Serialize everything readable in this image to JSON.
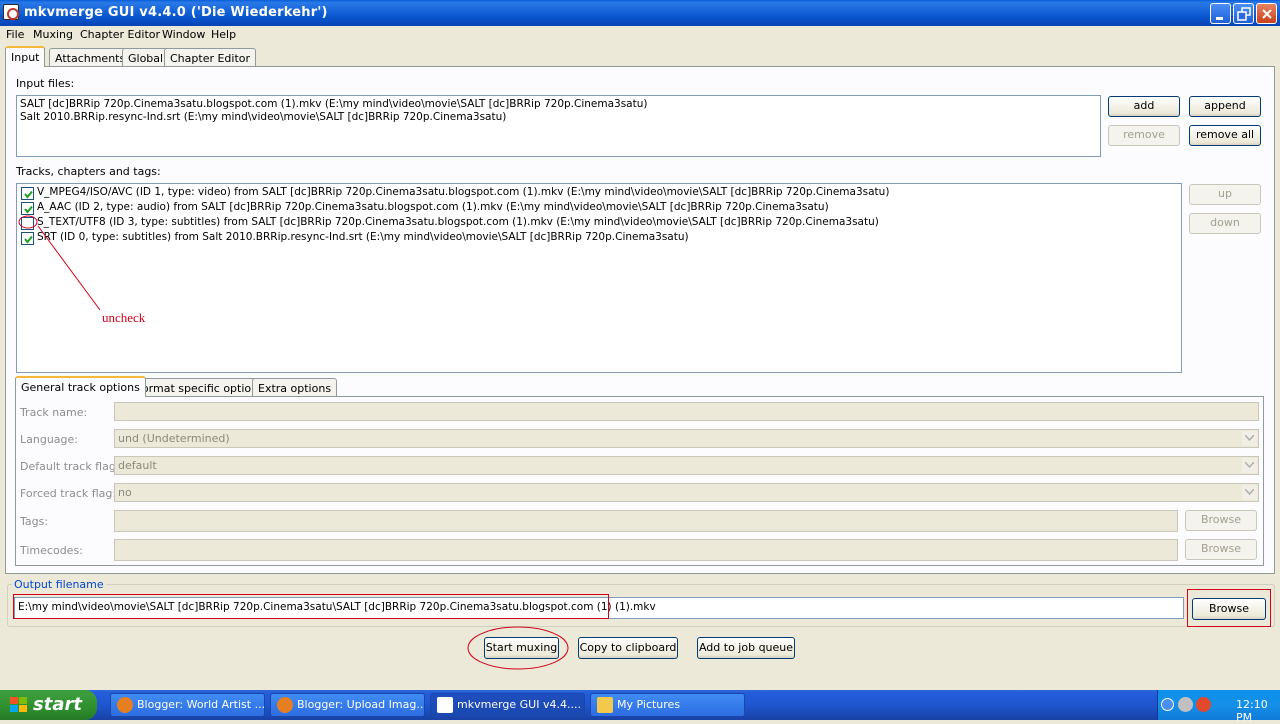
{
  "window": {
    "title": "mkvmerge GUI v4.4.0 ('Die Wiederkehr')"
  },
  "menu": [
    "File",
    "Muxing",
    "Chapter Editor",
    "Window",
    "Help"
  ],
  "tabs": [
    "Input",
    "Attachments",
    "Global",
    "Chapter Editor"
  ],
  "input_files": {
    "label": "Input files:",
    "files": [
      "SALT [dc]BRRip 720p.Cinema3satu.blogspot.com (1).mkv (E:\\my mind\\video\\movie\\SALT [dc]BRRip 720p.Cinema3satu)",
      "Salt 2010.BRRip.resync-Ind.srt (E:\\my mind\\video\\movie\\SALT [dc]BRRip 720p.Cinema3satu)"
    ],
    "buttons": {
      "add": "add",
      "append": "append",
      "remove": "remove",
      "remove_all": "remove all"
    }
  },
  "tracks": {
    "label": "Tracks, chapters and tags:",
    "items": [
      {
        "text": "V_MPEG4/ISO/AVC (ID 1, type: video) from SALT [dc]BRRip 720p.Cinema3satu.blogspot.com (1).mkv (E:\\my mind\\video\\movie\\SALT [dc]BRRip 720p.Cinema3satu)",
        "checked": true
      },
      {
        "text": "A_AAC (ID 2, type: audio) from SALT [dc]BRRip 720p.Cinema3satu.blogspot.com (1).mkv (E:\\my mind\\video\\movie\\SALT [dc]BRRip 720p.Cinema3satu)",
        "checked": true
      },
      {
        "text": "S_TEXT/UTF8 (ID 3, type: subtitles) from SALT [dc]BRRip 720p.Cinema3satu.blogspot.com (1).mkv (E:\\my mind\\video\\movie\\SALT [dc]BRRip 720p.Cinema3satu)",
        "checked": false
      },
      {
        "text": "SRT (ID 0, type: subtitles) from Salt 2010.BRRip.resync-Ind.srt (E:\\my mind\\video\\movie\\SALT [dc]BRRip 720p.Cinema3satu)",
        "checked": true
      }
    ],
    "buttons": {
      "up": "up",
      "down": "down"
    },
    "annotation": "uncheck"
  },
  "track_option_tabs": [
    "General track options",
    "Format specific options",
    "Extra options"
  ],
  "track_options": {
    "track_name": {
      "label": "Track name:",
      "value": ""
    },
    "language": {
      "label": "Language:",
      "value": "und (Undetermined)"
    },
    "default_flag": {
      "label": "Default track flag:",
      "value": "default"
    },
    "forced_flag": {
      "label": "Forced track flag:",
      "value": "no"
    },
    "tags": {
      "label": "Tags:",
      "value": "",
      "browse": "Browse"
    },
    "timecodes": {
      "label": "Timecodes:",
      "value": "",
      "browse": "Browse"
    }
  },
  "output": {
    "label": "Output filename",
    "value": "E:\\my mind\\video\\movie\\SALT [dc]BRRip 720p.Cinema3satu\\SALT [dc]BRRip 720p.Cinema3satu.blogspot.com (1) (1).mkv",
    "browse": "Browse"
  },
  "actions": {
    "start": "Start muxing",
    "copy": "Copy to clipboard",
    "queue": "Add to job queue"
  },
  "taskbar": {
    "start": "start",
    "tasks": [
      "Blogger: World Artist ...",
      "Blogger: Upload Imag...",
      "mkvmerge GUI v4.4....",
      "My Pictures"
    ],
    "clock": "12:10 PM"
  },
  "colors": {
    "annotation": "#d0021b",
    "titlebar": "#0b58d0"
  }
}
